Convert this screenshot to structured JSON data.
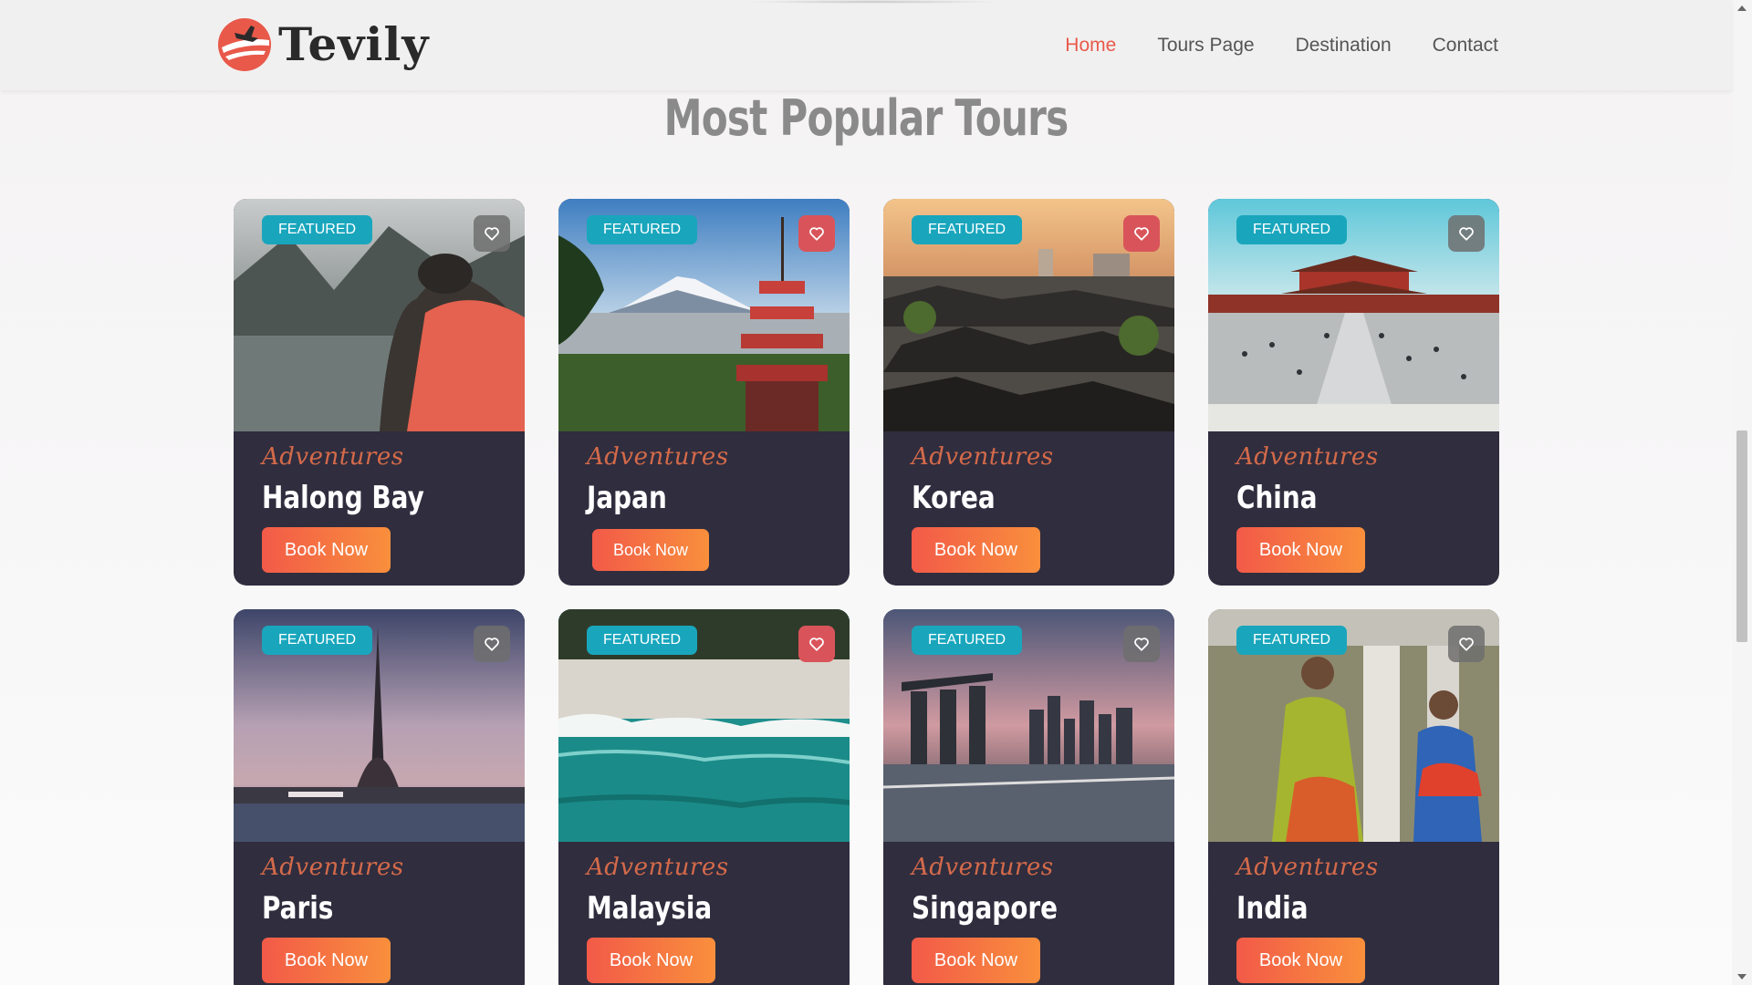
{
  "brand": {
    "name": "Tevily",
    "accent": "#e8594a"
  },
  "nav": [
    {
      "label": "Home",
      "active": true
    },
    {
      "label": "Tours Page",
      "active": false
    },
    {
      "label": "Destination",
      "active": false
    },
    {
      "label": "Contact",
      "active": false
    }
  ],
  "section": {
    "title": "Most Popular Tours"
  },
  "tours": [
    {
      "badge": "FEATURED",
      "subtitle": "Adventures",
      "title": "Halong Bay",
      "button": "Book Now",
      "favorite_icon": "heart-icon",
      "favorite_active": false
    },
    {
      "badge": "FEATURED",
      "subtitle": "Adventures",
      "title": "Japan",
      "button": "Book Now",
      "favorite_icon": "heart-icon",
      "favorite_active": true
    },
    {
      "badge": "FEATURED",
      "subtitle": "Adventures",
      "title": "Korea",
      "button": "Book Now",
      "favorite_icon": "heart-icon",
      "favorite_active": true
    },
    {
      "badge": "FEATURED",
      "subtitle": "Adventures",
      "title": "China",
      "button": "Book Now",
      "favorite_icon": "heart-icon",
      "favorite_active": false
    },
    {
      "badge": "FEATURED",
      "subtitle": "Adventures",
      "title": "Paris",
      "button": "Book Now",
      "favorite_icon": "heart-icon",
      "favorite_active": false
    },
    {
      "badge": "FEATURED",
      "subtitle": "Adventures",
      "title": "Malaysia",
      "button": "Book Now",
      "favorite_icon": "heart-icon",
      "favorite_active": true
    },
    {
      "badge": "FEATURED",
      "subtitle": "Adventures",
      "title": "Singapore",
      "button": "Book Now",
      "favorite_icon": "heart-icon",
      "favorite_active": false
    },
    {
      "badge": "FEATURED",
      "subtitle": "Adventures",
      "title": "India",
      "button": "Book Now",
      "favorite_icon": "heart-icon",
      "favorite_active": false
    }
  ],
  "colors": {
    "card_bg": "#302d3e",
    "badge_bg": "#19a6bd",
    "button_gradient_start": "#f25a48",
    "button_gradient_end": "#f98f3c",
    "subtitle": "#d46a4a"
  }
}
